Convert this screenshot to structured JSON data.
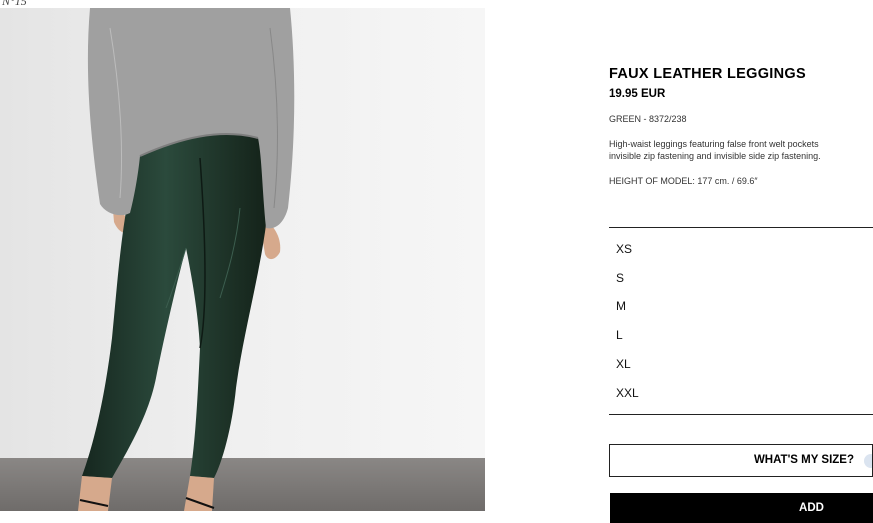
{
  "corner_mark": "N°15",
  "product": {
    "title": "FAUX LEATHER LEGGINGS",
    "price": "19.95 EUR",
    "color_ref": "GREEN - 8372/238",
    "description_line1": "High-waist leggings featuring false front welt pockets",
    "description_line2": "invisible zip fastening and invisible side zip fastening.",
    "model_height": "HEIGHT OF MODEL: 177 cm. / 69.6″"
  },
  "sizes": [
    "XS",
    "S",
    "M",
    "L",
    "XL",
    "XXL"
  ],
  "buttons": {
    "size_guide": "WHAT'S MY SIZE?",
    "add": "ADD"
  },
  "colors": {
    "legging": "#1d3329",
    "sweater": "#9a9a9a",
    "floor": "#7d7a78",
    "backdrop": "#eeeeee"
  }
}
